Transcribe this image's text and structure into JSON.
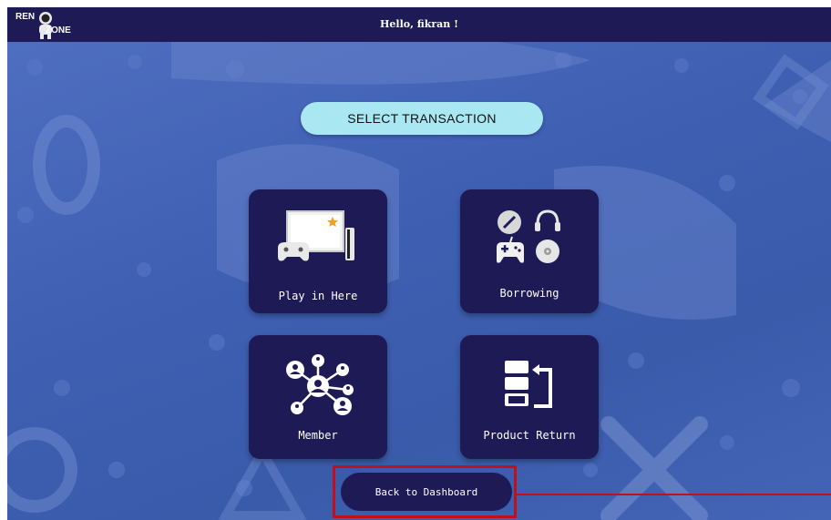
{
  "header": {
    "logo_text_top": "REN",
    "logo_text_bottom": "ZONE",
    "greeting": "Hello, fikran !"
  },
  "main": {
    "title": "SELECT TRANSACTION",
    "cards": [
      {
        "label": "Play in Here",
        "icon": "tv-console-icon"
      },
      {
        "label": "Borrowing",
        "icon": "accessories-icon"
      },
      {
        "label": "Member",
        "icon": "network-members-icon"
      },
      {
        "label": "Product Return",
        "icon": "return-icon"
      }
    ],
    "back_button": "Back to Dashboard"
  },
  "colors": {
    "navy": "#1e1a55",
    "pill": "#a9e7f2",
    "background": "#4464b7",
    "highlight": "#c0111b",
    "star": "#f0a020"
  }
}
